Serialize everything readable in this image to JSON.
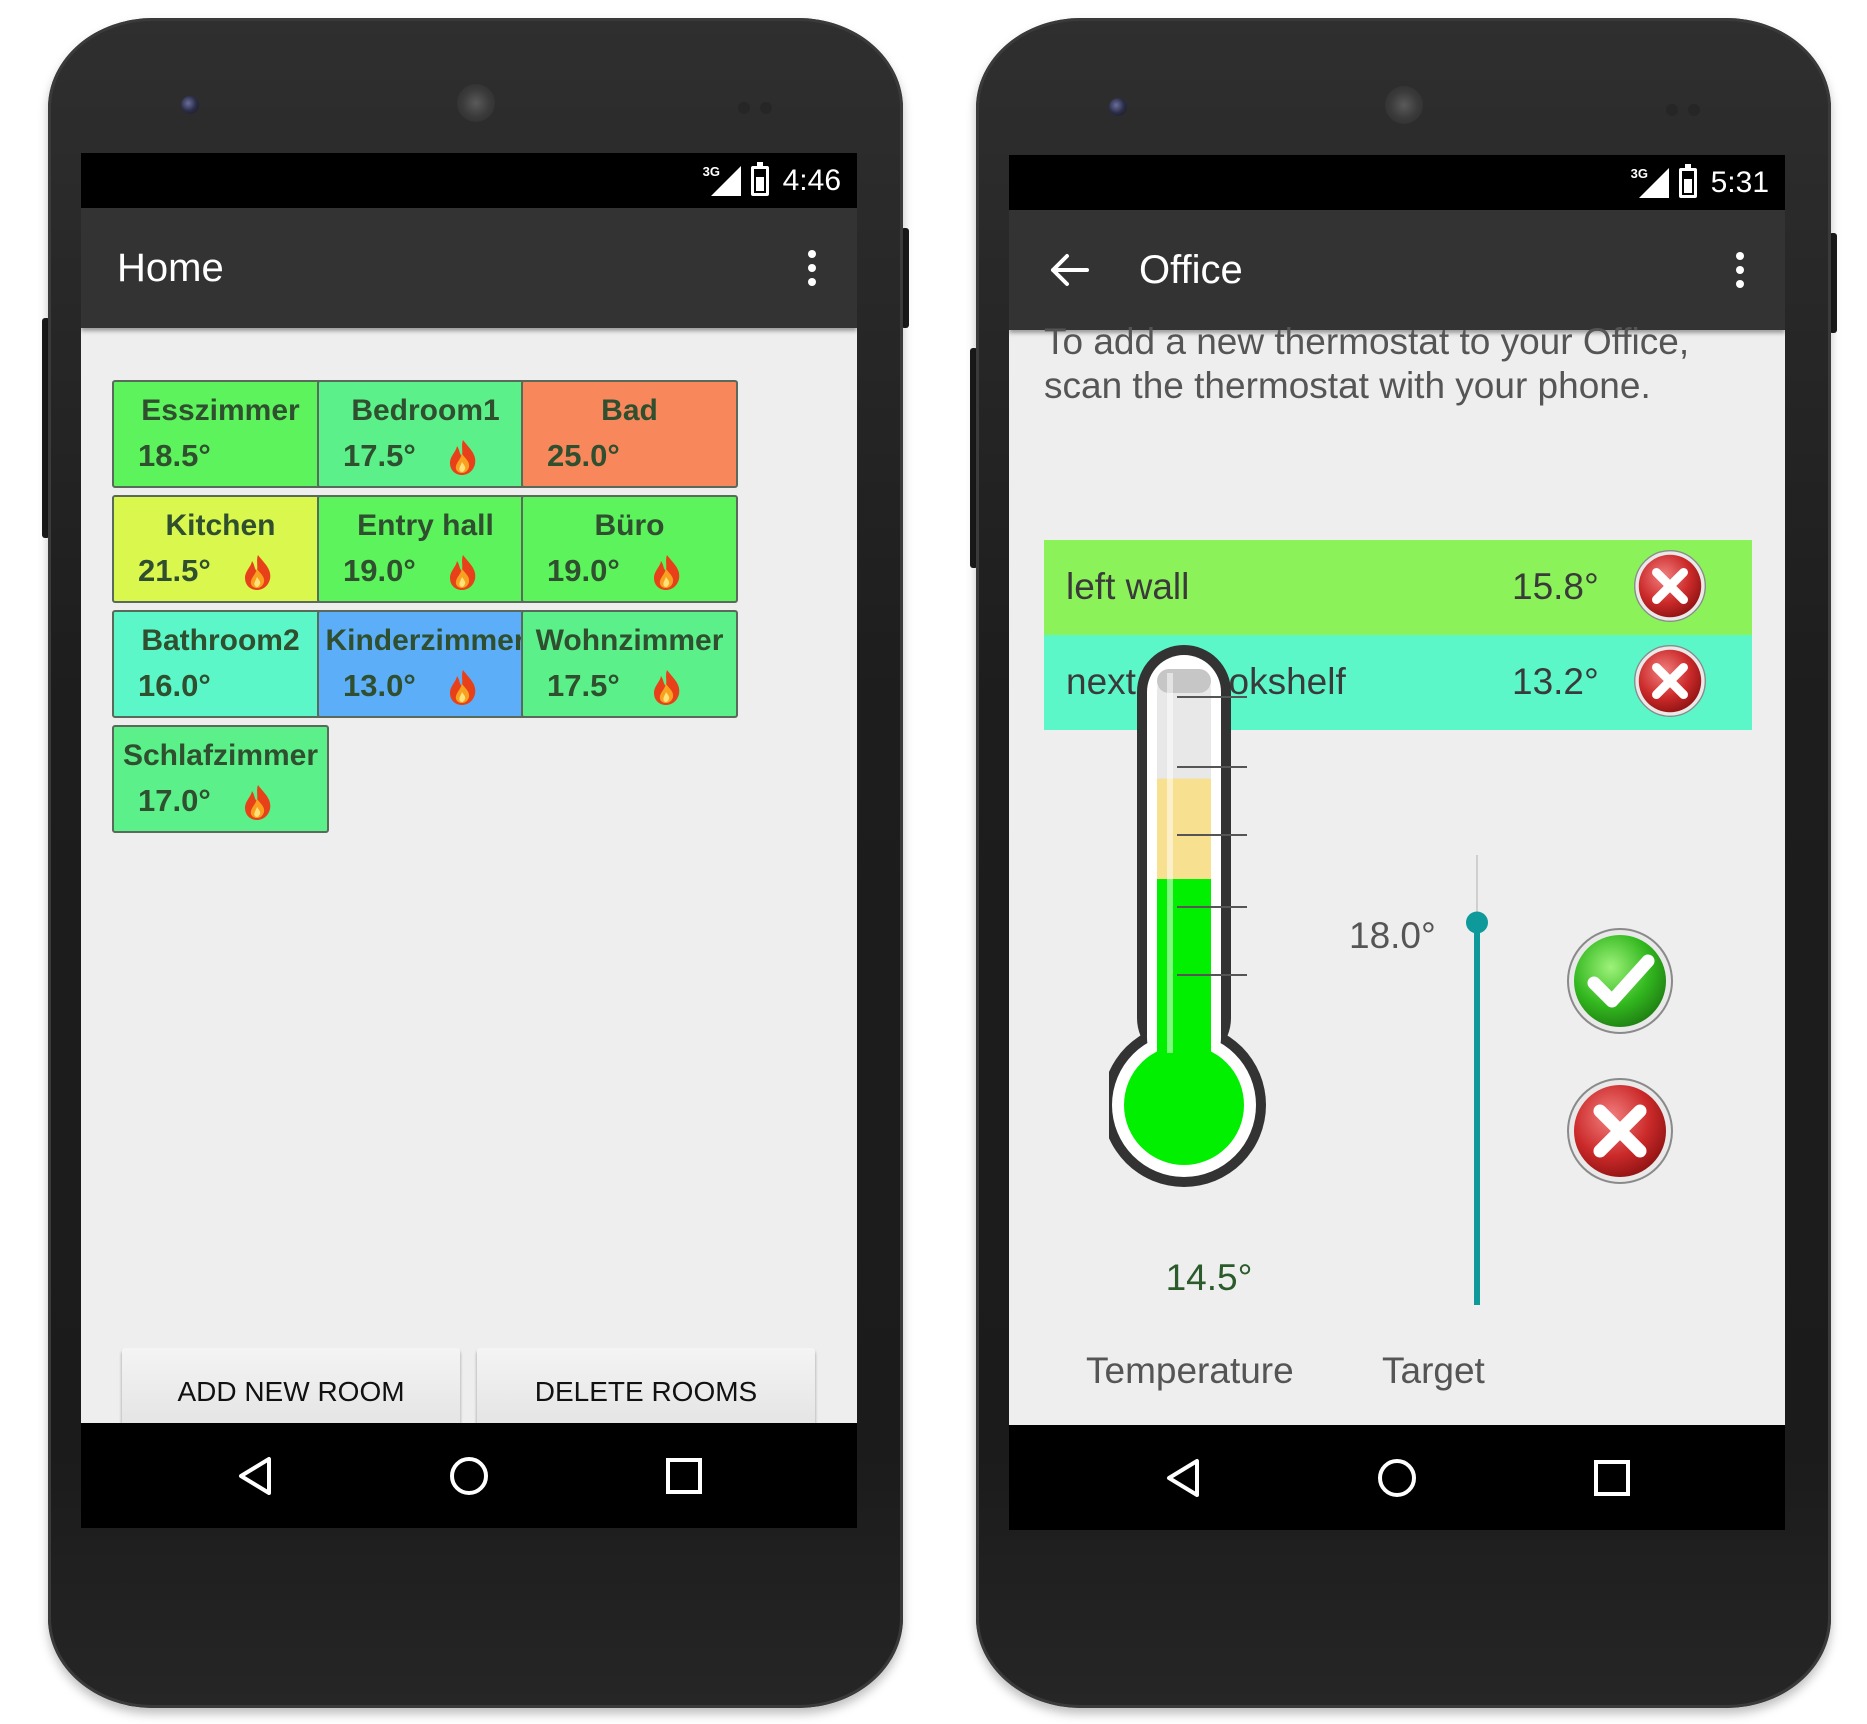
{
  "colors": {
    "green": "#5cf35c",
    "light_green": "#5cf08a",
    "orange": "#f9875c",
    "yellow": "#d9f74d",
    "aqua": "#5cf7c8",
    "blue": "#5caef8",
    "row_green": "#8cf25a",
    "row_aqua": "#5cf7c8",
    "accent": "#0e9a9a"
  },
  "home_screen": {
    "status": {
      "network": "3G",
      "time": "4:46"
    },
    "title": "Home",
    "rooms": [
      {
        "name": "Esszimmer",
        "temp": "18.5°",
        "heating": false,
        "color": "#5cf35c"
      },
      {
        "name": "Bedroom1",
        "temp": "17.5°",
        "heating": true,
        "color": "#5cf08a"
      },
      {
        "name": "Bad",
        "temp": "25.0°",
        "heating": false,
        "color": "#f9875c"
      },
      {
        "name": "Kitchen",
        "temp": "21.5°",
        "heating": true,
        "color": "#d9f74d"
      },
      {
        "name": "Entry hall",
        "temp": "19.0°",
        "heating": true,
        "color": "#5cf35c"
      },
      {
        "name": "Büro",
        "temp": "19.0°",
        "heating": true,
        "color": "#5cf35c"
      },
      {
        "name": "Bathroom2",
        "temp": "16.0°",
        "heating": false,
        "color": "#5cf7c8"
      },
      {
        "name": "Kinderzimmer",
        "temp": "13.0°",
        "heating": true,
        "color": "#5caef8"
      },
      {
        "name": "Wohnzimmer",
        "temp": "17.5°",
        "heating": true,
        "color": "#5cf08a"
      },
      {
        "name": "Schlafzimmer",
        "temp": "17.0°",
        "heating": true,
        "color": "#5cf08a"
      }
    ],
    "buttons": {
      "add": "ADD NEW ROOM",
      "delete": "DELETE ROOMS"
    }
  },
  "office_screen": {
    "status": {
      "network": "3G",
      "time": "5:31"
    },
    "title": "Office",
    "instructions": "To add a new thermostat to your Office, scan the thermostat with your phone.",
    "thermostats": [
      {
        "name": "left wall",
        "temp": "15.8°",
        "color": "#8cf25a"
      },
      {
        "name": "next to bookshelf",
        "temp": "13.2°",
        "color": "#5cf7c8"
      }
    ],
    "thermometer": {
      "value": "14.5°",
      "current_fill_fraction": 0.5,
      "target_fill_fraction": 0.77
    },
    "target": {
      "value": "18.0°",
      "slider_fraction": 0.85
    },
    "labels": {
      "temperature": "Temperature",
      "target": "Target"
    }
  }
}
